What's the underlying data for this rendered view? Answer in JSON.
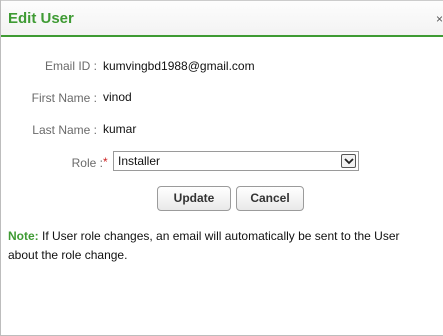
{
  "dialog": {
    "title": "Edit User",
    "close_glyph": "×"
  },
  "fields": {
    "email_label": "Email ID :",
    "email_value": "kumvingbd1988@gmail.com",
    "first_name_label": "First Name :",
    "first_name_value": "vinod",
    "last_name_label": "Last Name :",
    "last_name_value": "kumar",
    "role_label": "Role :",
    "role_required_mark": "*",
    "role_value": "Installer"
  },
  "buttons": {
    "update": "Update",
    "cancel": "Cancel"
  },
  "note": {
    "label": "Note:",
    "text": " If User role changes, an email will automatically be sent to the User about the role change."
  },
  "colors": {
    "accent": "#3f9b34",
    "required": "#cc2222"
  },
  "icons": {
    "close": "close-icon",
    "dropdown": "chevron-down-icon"
  }
}
